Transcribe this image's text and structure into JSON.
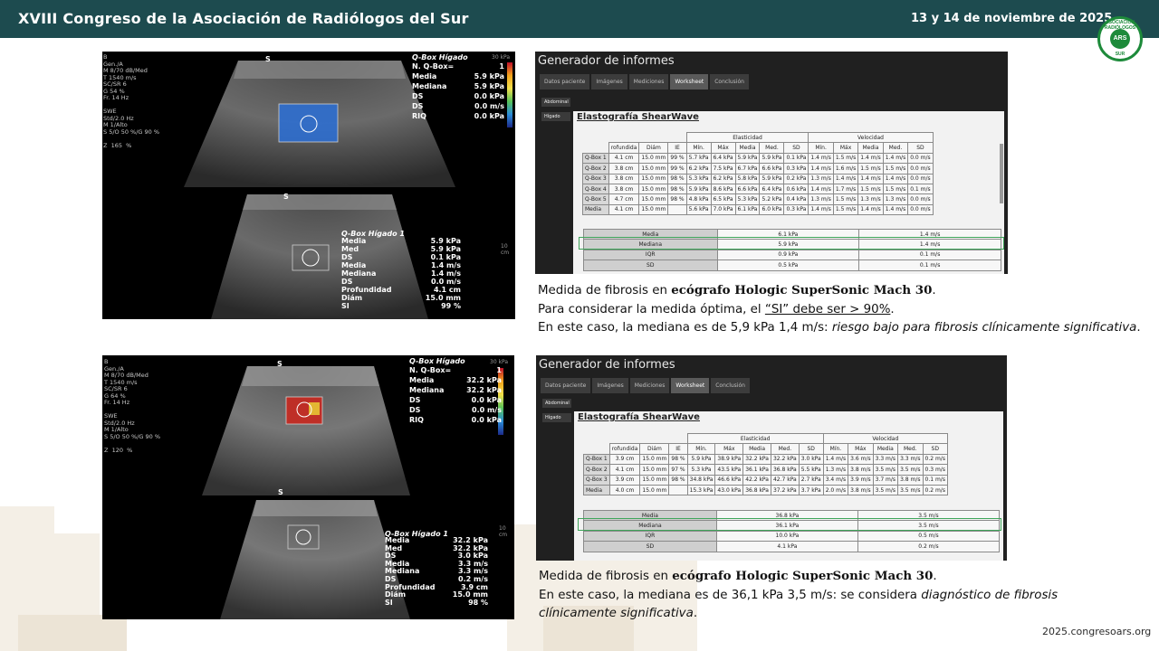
{
  "header": {
    "title": "XVIII Congreso de la Asociación de Radiólogos del Sur",
    "date": "13 y 14 de noviembre de 2025",
    "logo_top": "ASOCIACIÓN RADIÓLOGOS",
    "logo_center": "ARS",
    "logo_bottom": "SUR"
  },
  "footer": {
    "url": "2025.congresoars.org"
  },
  "us1": {
    "settings": "B\nGen./A\nM 8/70 dB/Med\nT 1540 m/s\nSC/SR 6\nG 54 %\nFr. 14 Hz\n\nSWE\nStd/2.0 Hz\nM 1/Alto\nS 5/O 50 %/G 90 %\n\nZ  165  %",
    "s_top": "S",
    "s_bottom": "S",
    "qbox_title": "Q-Box Hígado",
    "qbox_rows": [
      [
        "N. Q-Box=",
        "1"
      ],
      [
        "Media",
        "5.9 kPa"
      ],
      [
        "Mediana",
        "5.9 kPa"
      ],
      [
        "DS",
        "0.0 kPa"
      ],
      [
        "DS",
        "0.0 m/s"
      ],
      [
        "RIQ",
        "0.0 kPa"
      ]
    ],
    "box2_title": "Q-Box Hígado 1",
    "box2_rows": [
      [
        "Media",
        "5.9 kPa"
      ],
      [
        "Med",
        "5.9 kPa"
      ],
      [
        "DS",
        "0.1 kPa"
      ],
      [
        "Media",
        "1.4 m/s"
      ],
      [
        "Mediana",
        "1.4 m/s"
      ],
      [
        "DS",
        "0.0 m/s"
      ],
      [
        "",
        ""
      ],
      [
        "Profundidad",
        "4.1 cm"
      ],
      [
        "Diám",
        "15.0 mm"
      ],
      [
        "SI",
        "99 %"
      ]
    ],
    "scale_top": "30 kPa",
    "depth_unit": "10 cm"
  },
  "us2": {
    "settings": "B\nGen./A\nM 8/70 dB/Med\nT 1540 m/s\nSC/SR 6\nG 64 %\nFr. 14 Hz\n\nSWE\nStd/2.0 Hz\nM 1/Alto\nS 5/O 50 %/G 90 %\n\nZ  120  %",
    "s_top": "S",
    "s_bottom": "S",
    "qbox_title": "Q-Box Hígado",
    "qbox_rows": [
      [
        "N. Q-Box=",
        "1"
      ],
      [
        "Media",
        "32.2 kPa"
      ],
      [
        "Mediana",
        "32.2 kPa"
      ],
      [
        "DS",
        "0.0 kPa"
      ],
      [
        "DS",
        "0.0 m/s"
      ],
      [
        "RIQ",
        "0.0 kPa"
      ]
    ],
    "box2_title": "Q-Box Hígado 1",
    "box2_rows": [
      [
        "Media",
        "32.2 kPa"
      ],
      [
        "Med",
        "32.2 kPa"
      ],
      [
        "DS",
        "3.0 kPa"
      ],
      [
        "Media",
        "3.3 m/s"
      ],
      [
        "Mediana",
        "3.3 m/s"
      ],
      [
        "DS",
        "0.2 m/s"
      ],
      [
        "",
        ""
      ],
      [
        "Profundidad",
        "3.9 cm"
      ],
      [
        "Diám",
        "15.0 mm"
      ],
      [
        "SI",
        "98 %"
      ]
    ],
    "scale_top": "30 kPa",
    "depth_unit": "10 cm"
  },
  "report1": {
    "title": "Generador de informes",
    "tabs": [
      "Datos paciente",
      "Imágenes",
      "Mediciones",
      "Worksheet",
      "Conclusión"
    ],
    "active_tab": 3,
    "side": [
      "Abdominal",
      "Hígado"
    ],
    "sheet_title": "Elastografía ShearWave",
    "group_elast": "Elasticidad",
    "group_vel": "Velocidad",
    "head": [
      "",
      "rofundida",
      "Diám",
      "IE",
      "Mín.",
      "Máx",
      "Media",
      "Med.",
      "SD",
      "Mín.",
      "Máx",
      "Media",
      "Med.",
      "SD"
    ],
    "rows": [
      [
        "Q-Box 1",
        "4.1 cm",
        "15.0 mm",
        "99 %",
        "5.7 kPa",
        "6.4 kPa",
        "5.9 kPa",
        "5.9 kPa",
        "0.1 kPa",
        "1.4 m/s",
        "1.5 m/s",
        "1.4 m/s",
        "1.4 m/s",
        "0.0 m/s"
      ],
      [
        "Q-Box 2",
        "3.8 cm",
        "15.0 mm",
        "99 %",
        "6.2 kPa",
        "7.5 kPa",
        "6.7 kPa",
        "6.6 kPa",
        "0.3 kPa",
        "1.4 m/s",
        "1.6 m/s",
        "1.5 m/s",
        "1.5 m/s",
        "0.0 m/s"
      ],
      [
        "Q-Box 3",
        "3.8 cm",
        "15.0 mm",
        "98 %",
        "5.3 kPa",
        "6.2 kPa",
        "5.8 kPa",
        "5.9 kPa",
        "0.2 kPa",
        "1.3 m/s",
        "1.4 m/s",
        "1.4 m/s",
        "1.4 m/s",
        "0.0 m/s"
      ],
      [
        "Q-Box 4",
        "3.8 cm",
        "15.0 mm",
        "98 %",
        "5.9 kPa",
        "8.6 kPa",
        "6.6 kPa",
        "6.4 kPa",
        "0.6 kPa",
        "1.4 m/s",
        "1.7 m/s",
        "1.5 m/s",
        "1.5 m/s",
        "0.1 m/s"
      ],
      [
        "Q-Box 5",
        "4.7 cm",
        "15.0 mm",
        "98 %",
        "4.8 kPa",
        "6.5 kPa",
        "5.3 kPa",
        "5.2 kPa",
        "0.4 kPa",
        "1.3 m/s",
        "1.5 m/s",
        "1.3 m/s",
        "1.3 m/s",
        "0.0 m/s"
      ],
      [
        "Media",
        "4.1 cm",
        "15.0 mm",
        "",
        "5.6 kPa",
        "7.0 kPa",
        "6.1 kPa",
        "6.0 kPa",
        "0.3 kPa",
        "1.4 m/s",
        "1.5 m/s",
        "1.4 m/s",
        "1.4 m/s",
        "0.0 m/s"
      ]
    ],
    "summary": [
      [
        "Media",
        "6.1 kPa",
        "1.4 m/s"
      ],
      [
        "Mediana",
        "5.9 kPa",
        "1.4 m/s"
      ],
      [
        "IQR",
        "0.9 kPa",
        "0.1 m/s"
      ],
      [
        "SD",
        "0.5 kPa",
        "0.1 m/s"
      ]
    ]
  },
  "report2": {
    "title": "Generador de informes",
    "tabs": [
      "Datos paciente",
      "Imágenes",
      "Mediciones",
      "Worksheet",
      "Conclusión"
    ],
    "active_tab": 3,
    "side": [
      "Abdominal",
      "Hígado"
    ],
    "sheet_title": "Elastografía ShearWave",
    "group_elast": "Elasticidad",
    "group_vel": "Velocidad",
    "head": [
      "",
      "rofundida",
      "Diám",
      "IE",
      "Mín.",
      "Máx",
      "Media",
      "Med.",
      "SD",
      "Mín.",
      "Máx",
      "Media",
      "Med.",
      "SD"
    ],
    "rows": [
      [
        "Q-Box 1",
        "3.9 cm",
        "15.0 mm",
        "98 %",
        "5.9 kPa",
        "38.9 kPa",
        "32.2 kPa",
        "32.2 kPa",
        "3.0 kPa",
        "1.4 m/s",
        "3.6 m/s",
        "3.3 m/s",
        "3.3 m/s",
        "0.2 m/s"
      ],
      [
        "Q-Box 2",
        "4.1 cm",
        "15.0 mm",
        "97 %",
        "5.3 kPa",
        "43.5 kPa",
        "36.1 kPa",
        "36.8 kPa",
        "5.5 kPa",
        "1.3 m/s",
        "3.8 m/s",
        "3.5 m/s",
        "3.5 m/s",
        "0.3 m/s"
      ],
      [
        "Q-Box 3",
        "3.9 cm",
        "15.0 mm",
        "98 %",
        "34.8 kPa",
        "46.6 kPa",
        "42.2 kPa",
        "42.7 kPa",
        "2.7 kPa",
        "3.4 m/s",
        "3.9 m/s",
        "3.7 m/s",
        "3.8 m/s",
        "0.1 m/s"
      ],
      [
        "Media",
        "4.0 cm",
        "15.0 mm",
        "",
        "15.3 kPa",
        "43.0 kPa",
        "36.8 kPa",
        "37.2 kPa",
        "3.7 kPa",
        "2.0 m/s",
        "3.8 m/s",
        "3.5 m/s",
        "3.5 m/s",
        "0.2 m/s"
      ]
    ],
    "summary": [
      [
        "Media",
        "36.8 kPa",
        "3.5 m/s"
      ],
      [
        "Mediana",
        "36.1 kPa",
        "3.5 m/s"
      ],
      [
        "IQR",
        "10.0 kPa",
        "0.5 m/s"
      ],
      [
        "SD",
        "4.1 kPa",
        "0.2 m/s"
      ]
    ]
  },
  "caption1": {
    "l1_pre": "Medida de fibrosis en ",
    "l1_bold": "ecógrafo Hologic SuperSonic Mach 30",
    "l1_post": ".",
    "l2_pre": "Para considerar la medida óptima, el ",
    "l2_u": "“SI” debe ser > 90%",
    "l2_post": ".",
    "l3_pre": "En este caso, la mediana es de 5,9 kPa 1,4 m/s: ",
    "l3_italic": "riesgo bajo para fibrosis clínicamente significativa",
    "l3_post": "."
  },
  "caption2": {
    "l1_pre": "Medida de fibrosis en ",
    "l1_bold": "ecógrafo Hologic SuperSonic Mach 30",
    "l1_post": ".",
    "l2_pre": "En este caso, la mediana es de 36,1 kPa 3,5 m/s: se considera ",
    "l2_italic": "diagnóstico de fibrosis clínicamente significativa",
    "l2_post": "."
  },
  "colors": {
    "header_bg": "#1d4b4f",
    "highlight": "#3fa55a",
    "swe_low": "#2a6fd6",
    "swe_high": "#c8281f"
  }
}
